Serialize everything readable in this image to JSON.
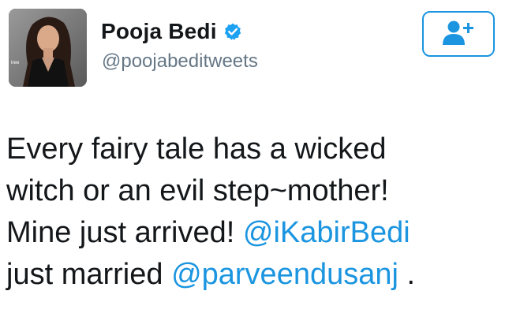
{
  "user": {
    "display_name": "Pooja Bedi",
    "handle": "@poojabeditweets",
    "verified": true,
    "avatar_icon": "profile-photo"
  },
  "follow_button": {
    "icon": "follow-user-plus-icon",
    "accent_color": "#1b95e0"
  },
  "tweet": {
    "line1": "Every fairy tale has a wicked",
    "line2": "witch or an evil step~mother!",
    "line3_text": "Mine just arrived! ",
    "mention1": "@iKabirBedi",
    "line4_text": "just married ",
    "mention2": "@parveendusanj",
    "line4_tail": " ."
  },
  "colors": {
    "text": "#14171a",
    "secondary": "#657786",
    "link": "#1b95e0",
    "verified": "#1da1f2"
  }
}
